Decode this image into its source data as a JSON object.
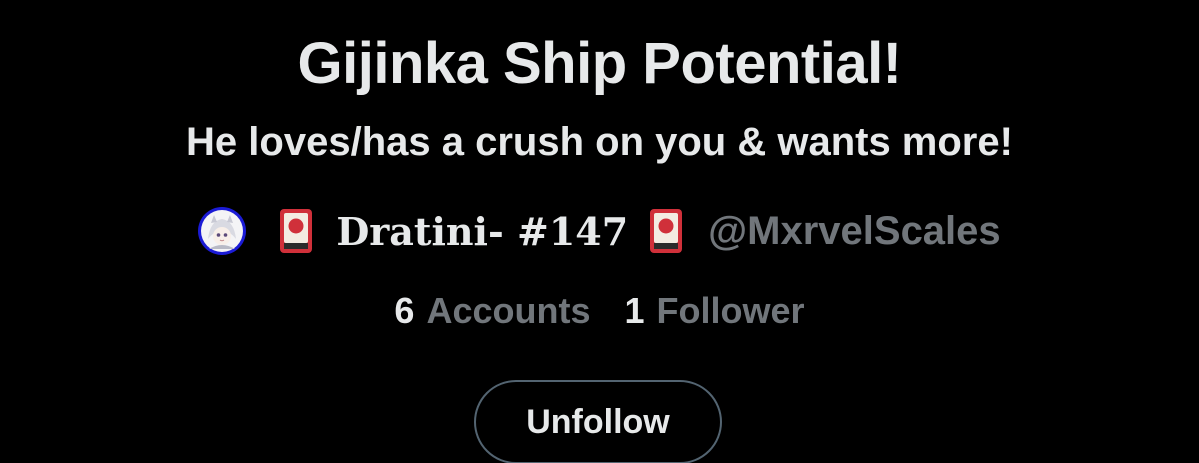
{
  "profile": {
    "title": "Gijinka Ship Potential!",
    "subtitle": "He loves/has a crush on you & wants more!",
    "display_name": "Dratini- #147",
    "handle": "@MxrvelScales",
    "avatar_icon": "anime-avatar-icon",
    "card_icon": "hanafuda-card-icon"
  },
  "stats": {
    "accounts_count": "6",
    "accounts_label": "Accounts",
    "followers_count": "1",
    "followers_label": "Follower"
  },
  "actions": {
    "unfollow_label": "Unfollow"
  },
  "colors": {
    "background": "#000000",
    "primary_text": "#e7e9ea",
    "secondary_text": "#71767b",
    "button_border": "#536471",
    "avatar_ring": "#1b1bd6",
    "card_red": "#d0303a"
  }
}
